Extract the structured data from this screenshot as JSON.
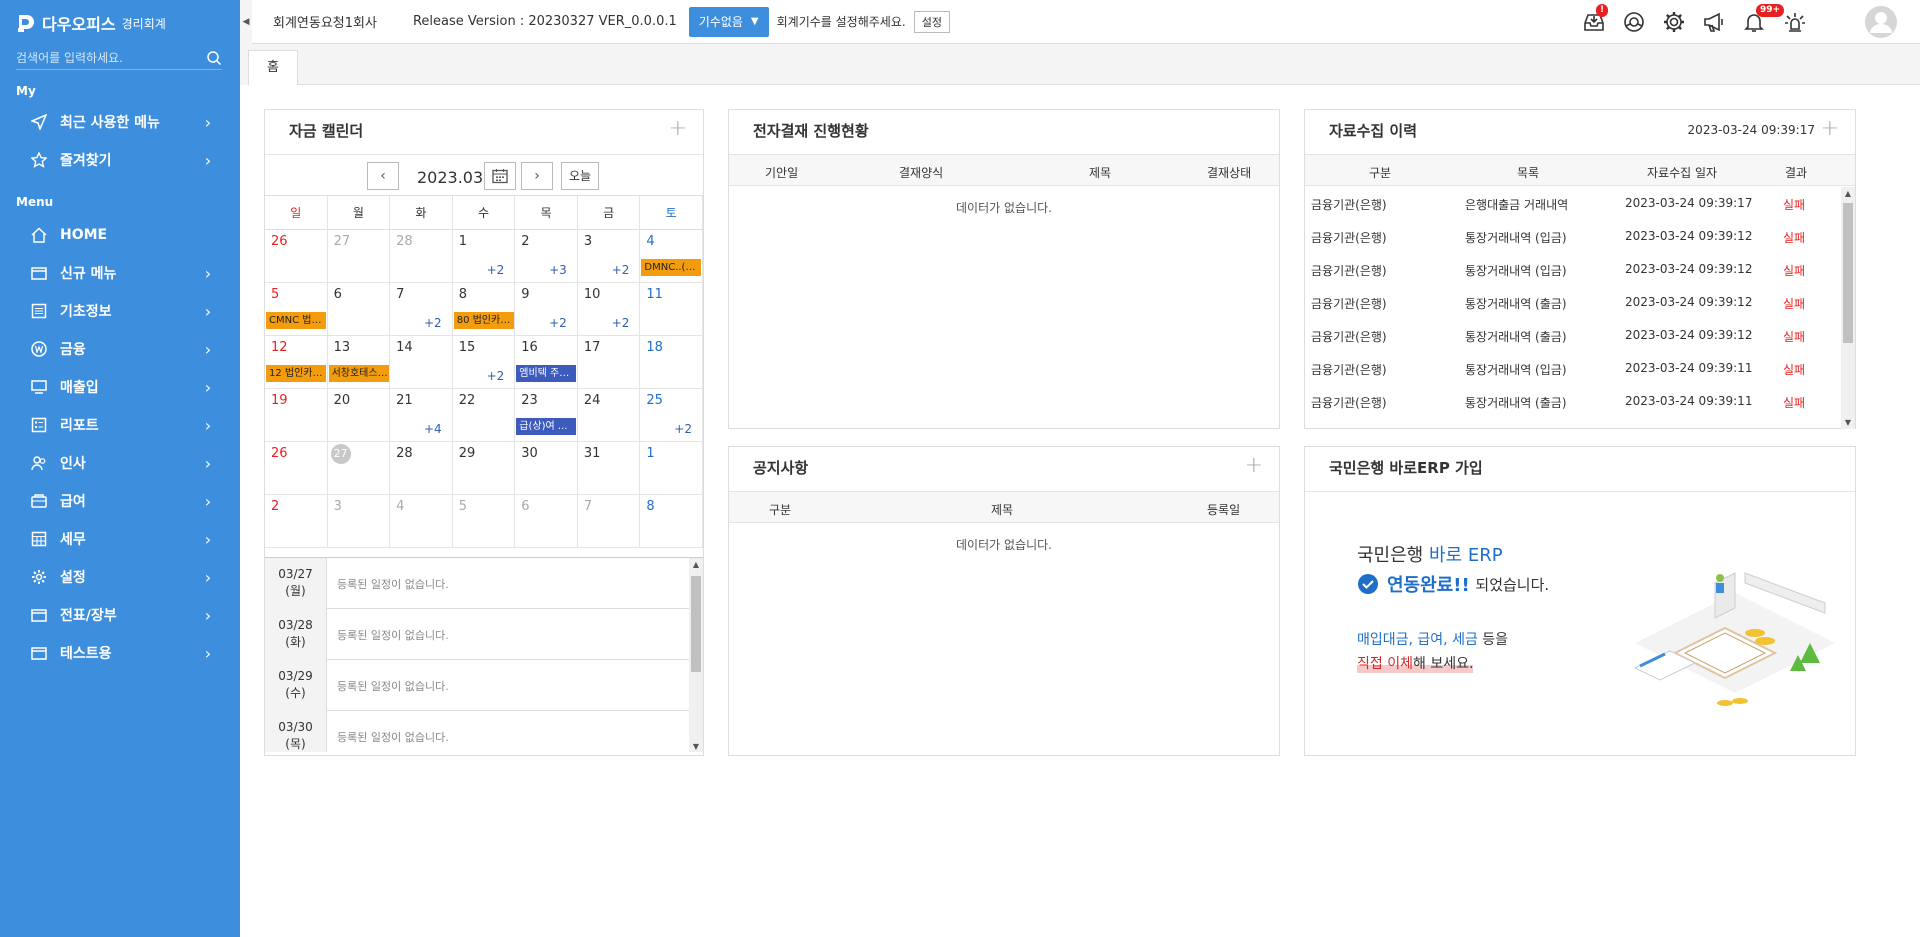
{
  "app": {
    "name": "다우오피스",
    "sub": "경리회계"
  },
  "sidebar": {
    "search_placeholder": "검색어를 입력하세요.",
    "sec_my": "My",
    "sec_menu": "Menu",
    "my_items": [
      {
        "label": "최근 사용한 메뉴",
        "icon": "send-icon"
      },
      {
        "label": "즐겨찾기",
        "icon": "star-icon"
      }
    ],
    "menu_items": [
      {
        "label": "HOME",
        "icon": "home-icon",
        "chevron": false
      },
      {
        "label": "신규 메뉴",
        "icon": "folder-icon",
        "chevron": true
      },
      {
        "label": "기초정보",
        "icon": "list-icon",
        "chevron": true
      },
      {
        "label": "금융",
        "icon": "won-icon",
        "chevron": true
      },
      {
        "label": "매출입",
        "icon": "monitor-icon",
        "chevron": true
      },
      {
        "label": "리포트",
        "icon": "report-icon",
        "chevron": true
      },
      {
        "label": "인사",
        "icon": "people-icon",
        "chevron": true
      },
      {
        "label": "급여",
        "icon": "wallet-icon",
        "chevron": true
      },
      {
        "label": "세무",
        "icon": "calculator-icon",
        "chevron": true
      },
      {
        "label": "설정",
        "icon": "gear-icon",
        "chevron": true
      },
      {
        "label": "전표/장부",
        "icon": "folder-icon",
        "chevron": true
      },
      {
        "label": "테스트용",
        "icon": "folder-icon",
        "chevron": true
      }
    ]
  },
  "topbar": {
    "company": "회계연동요청1회사",
    "release": "Release Version : 20230327 VER_0.0.0.1",
    "period_label": "기수없음",
    "notice": "회계기수를 설정해주세요.",
    "set_label": "설정",
    "inbox_badge": "!",
    "alarm_badge": "99+"
  },
  "tabs": {
    "home": "홈"
  },
  "calendar": {
    "title": "자금 캘린더",
    "month": "2023.03",
    "today_label": "오늘",
    "dow": [
      "일",
      "월",
      "화",
      "수",
      "목",
      "금",
      "토"
    ],
    "weeks": [
      [
        {
          "d": "26",
          "m": "o"
        },
        {
          "d": "27",
          "m": "o"
        },
        {
          "d": "28",
          "m": "o"
        },
        {
          "d": "1",
          "more": "+2"
        },
        {
          "d": "2",
          "more": "+3"
        },
        {
          "d": "3",
          "more": "+2"
        },
        {
          "d": "4",
          "ev": "DMNC..(주)...",
          "evc": "o"
        }
      ],
      [
        {
          "d": "5",
          "ev": "CMNC 법인...",
          "evc": "o"
        },
        {
          "d": "6"
        },
        {
          "d": "7",
          "more": "+2"
        },
        {
          "d": "8",
          "ev": "80 법인카드...",
          "evc": "o"
        },
        {
          "d": "9",
          "more": "+2"
        },
        {
          "d": "10",
          "more": "+2"
        },
        {
          "d": "11"
        }
      ],
      [
        {
          "d": "12",
          "ev": "12 법인카드...",
          "evc": "o"
        },
        {
          "d": "13",
          "ev": "서창호테스트...",
          "evc": "o"
        },
        {
          "d": "14"
        },
        {
          "d": "15",
          "more": "+2"
        },
        {
          "d": "16",
          "ev": "엠비텍 주식...",
          "evc": "b"
        },
        {
          "d": "17"
        },
        {
          "d": "18"
        }
      ],
      [
        {
          "d": "19"
        },
        {
          "d": "20"
        },
        {
          "d": "21",
          "more": "+4"
        },
        {
          "d": "22"
        },
        {
          "d": "23",
          "ev": "급(상)여 ...",
          "evc": "b"
        },
        {
          "d": "24"
        },
        {
          "d": "25",
          "more": "+2"
        }
      ],
      [
        {
          "d": "26"
        },
        {
          "d": "27",
          "today": true
        },
        {
          "d": "28"
        },
        {
          "d": "29"
        },
        {
          "d": "30"
        },
        {
          "d": "31"
        },
        {
          "d": "1"
        }
      ],
      [
        {
          "d": "2",
          "m": "n"
        },
        {
          "d": "3",
          "m": "n"
        },
        {
          "d": "4",
          "m": "n"
        },
        {
          "d": "5",
          "m": "n"
        },
        {
          "d": "6",
          "m": "n"
        },
        {
          "d": "7",
          "m": "n"
        },
        {
          "d": "8",
          "m": "n"
        }
      ]
    ],
    "schedule": [
      {
        "date": "03/27",
        "day": "(월)",
        "text": "등록된 일정이 없습니다."
      },
      {
        "date": "03/28",
        "day": "(화)",
        "text": "등록된 일정이 없습니다."
      },
      {
        "date": "03/29",
        "day": "(수)",
        "text": "등록된 일정이 없습니다."
      },
      {
        "date": "03/30",
        "day": "(목)",
        "text": "등록된 일정이 없습니다."
      }
    ]
  },
  "approval": {
    "title": "전자결재 진행현황",
    "cols": [
      "기안일",
      "결재양식",
      "제목",
      "결재상태"
    ],
    "empty": "데이터가 없습니다."
  },
  "collection": {
    "title": "자료수집 이력",
    "timestamp": "2023-03-24 09:39:17",
    "cols": [
      "구분",
      "목록",
      "자료수집 일자",
      "결과"
    ],
    "rows": [
      [
        "금융기관(은행)",
        "은행대출금 거래내역",
        "2023-03-24 09:39:17",
        "실패"
      ],
      [
        "금융기관(은행)",
        "통장거래내역 (입금)",
        "2023-03-24 09:39:12",
        "실패"
      ],
      [
        "금융기관(은행)",
        "통장거래내역 (입금)",
        "2023-03-24 09:39:12",
        "실패"
      ],
      [
        "금융기관(은행)",
        "통장거래내역 (출금)",
        "2023-03-24 09:39:12",
        "실패"
      ],
      [
        "금융기관(은행)",
        "통장거래내역 (출금)",
        "2023-03-24 09:39:12",
        "실패"
      ],
      [
        "금융기관(은행)",
        "통장거래내역 (입금)",
        "2023-03-24 09:39:11",
        "실패"
      ],
      [
        "금융기관(은행)",
        "통장거래내역 (출금)",
        "2023-03-24 09:39:11",
        "실패"
      ]
    ]
  },
  "notice": {
    "title": "공지사항",
    "cols": [
      "구분",
      "제목",
      "등록일"
    ],
    "empty": "데이터가 없습니다."
  },
  "kbpromo": {
    "title": "국민은행 바로ERP 가입",
    "line1a": "국민은행",
    "line1b": "바로 ERP",
    "line2a": "연동완료!!",
    "line2b": "되었습니다.",
    "line3a": "매입대금, 급여, 세금",
    "line3b": "등을",
    "line4a": "직접 이체",
    "line4b": "해 보세요."
  }
}
